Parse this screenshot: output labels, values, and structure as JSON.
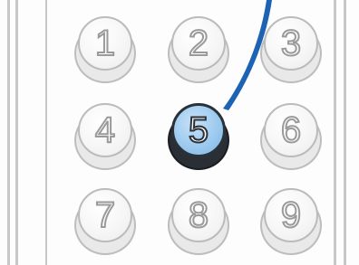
{
  "keypad": {
    "keys": [
      {
        "label": "1"
      },
      {
        "label": "2"
      },
      {
        "label": "3"
      },
      {
        "label": "4"
      },
      {
        "label": "5"
      },
      {
        "label": "6"
      },
      {
        "label": "7"
      },
      {
        "label": "8"
      },
      {
        "label": "9"
      }
    ],
    "selected_key": "5"
  },
  "colors": {
    "selected_key_fill": "#9dcaef",
    "pointer": "#1d63b3"
  }
}
